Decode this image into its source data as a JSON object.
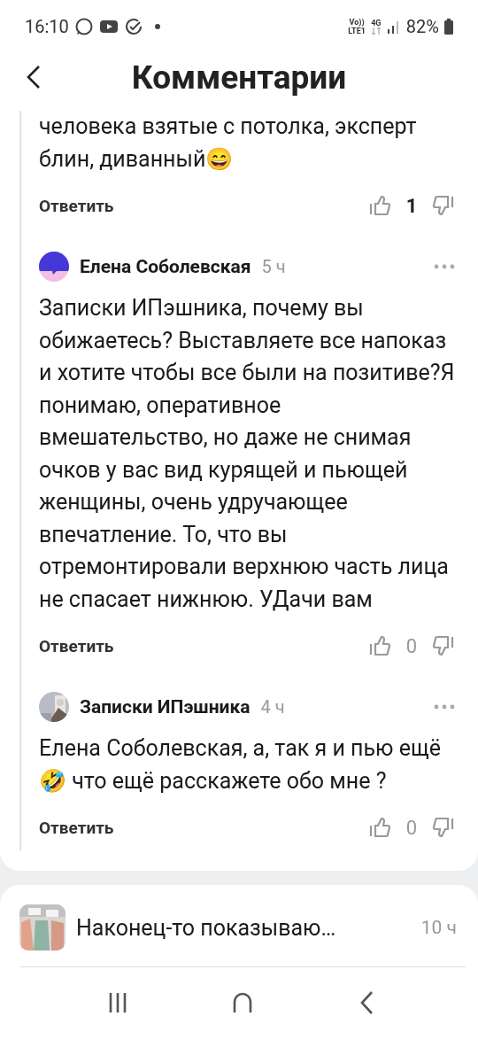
{
  "status_bar": {
    "time": "16:10",
    "network_top": "Vo))",
    "network_bottom": "LTE1",
    "data_type": "4G",
    "battery": "82%"
  },
  "header": {
    "title": "Комментарии"
  },
  "comments": [
    {
      "kind": "continued",
      "text": "человека взятые с потолка, эксперт блин, диванный😄",
      "reply": "Ответить",
      "likes": "1",
      "liked": true
    },
    {
      "kind": "full",
      "avatar": {
        "kind": "brand"
      },
      "author": "Елена Соболевская",
      "time": "5 ч",
      "text": "Записки ИПэшника, почему вы обижаетесь? Выставляете все напоказ и хотите чтобы все были на позитиве?Я понимаю, оперативное вмешательство, но даже не снимая очков у вас вид курящей и пьющей женщины, очень удручающее впечатление. То, что вы отремонтировали верхнюю часть лица не спасает нижнюю. УДачи вам",
      "reply": "Ответить",
      "likes": "0",
      "liked": false
    },
    {
      "kind": "full",
      "author": "Записки ИПэшника",
      "time": "4 ч",
      "text": "Елена Соболевская, а, так я и пью ещё 🤣 что ещё расскажете обо мне ?",
      "reply": "Ответить",
      "likes": "0",
      "liked": false
    }
  ],
  "article": {
    "title": "Наконец-то показываю…",
    "time": "10 ч"
  }
}
